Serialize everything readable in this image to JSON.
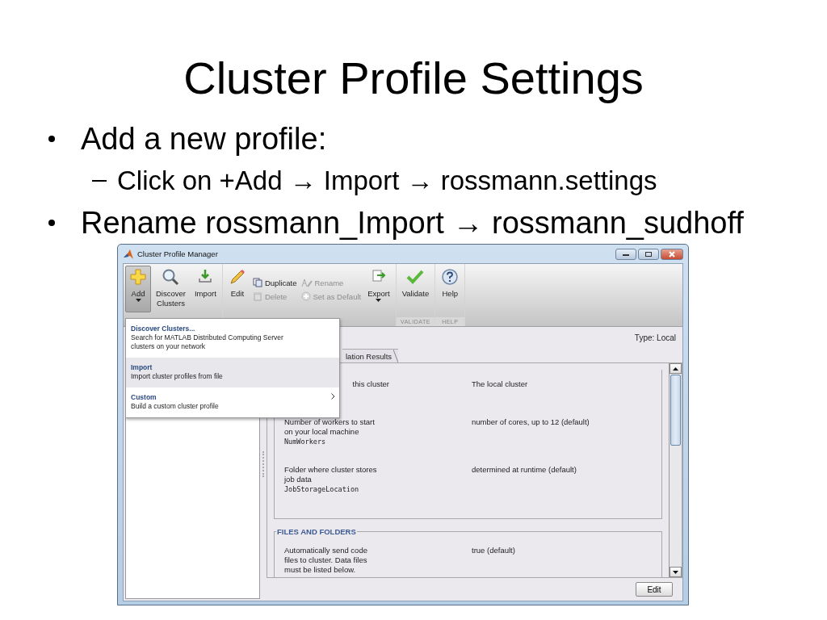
{
  "slide": {
    "title": "Cluster Profile Settings",
    "bullets": [
      {
        "text": "Add a new profile:",
        "children": [
          {
            "text": "Click on +Add → Import → rossmann.settings"
          }
        ]
      },
      {
        "text": "Rename rossmann_Import → rossmann_sudhoff"
      }
    ]
  },
  "window": {
    "title": "Cluster Profile Manager"
  },
  "toolbar": {
    "groups": [
      {
        "items": [
          {
            "kind": "large",
            "label": "Add",
            "selected": true,
            "dropdown": true
          },
          {
            "kind": "large",
            "label": "Discover\nClusters",
            "selected": false
          },
          {
            "kind": "large",
            "label": "Import",
            "selected": false
          }
        ]
      },
      {
        "items": [
          {
            "kind": "large",
            "label": "Edit",
            "selected": false
          },
          {
            "kind": "stack",
            "items": [
              {
                "label": "Duplicate",
                "disabled": false
              },
              {
                "label": "Delete",
                "disabled": true
              }
            ]
          },
          {
            "kind": "stack",
            "items": [
              {
                "label": "Rename",
                "disabled": true
              },
              {
                "label": "Set as Default",
                "disabled": true
              }
            ]
          },
          {
            "kind": "large",
            "label": "Export",
            "selected": false,
            "dropdown": true
          }
        ]
      },
      {
        "label": "VALIDATE",
        "items": [
          {
            "kind": "large",
            "label": "Validate",
            "selected": false
          }
        ]
      },
      {
        "label": "HELP",
        "items": [
          {
            "kind": "large",
            "label": "Help",
            "selected": false
          }
        ]
      }
    ]
  },
  "menu": {
    "items": [
      {
        "title": "Discover Clusters...",
        "description": "Search for MATLAB Distributed Computing Server\nclusters on your network",
        "selected": false,
        "submenu": false
      },
      {
        "title": "Import",
        "description": "Import cluster profiles from file",
        "selected": true,
        "submenu": false
      },
      {
        "title": "Custom",
        "description": "Build a custom cluster profile",
        "selected": false,
        "submenu": true
      }
    ]
  },
  "details": {
    "type_label": "Type: Local",
    "tabs": [
      {
        "label": "lation Results",
        "selected": false
      }
    ],
    "sections": [
      {
        "rows": [
          {
            "description": "this cluster",
            "clipped": true,
            "value": "The local cluster"
          },
          {
            "description": "Number of workers to start\non your local machine",
            "property": "NumWorkers",
            "value": "number of cores, up to 12 (default)"
          },
          {
            "description": "Folder where cluster stores\njob data",
            "property": "JobStorageLocation",
            "value": "determined at runtime (default)"
          }
        ]
      },
      {
        "title": "FILES AND FOLDERS",
        "rows": [
          {
            "description": "Automatically send code\nfiles to cluster. Data files\nmust be listed below.",
            "value": "true (default)"
          }
        ]
      }
    ]
  },
  "buttons": [
    "Edit"
  ]
}
